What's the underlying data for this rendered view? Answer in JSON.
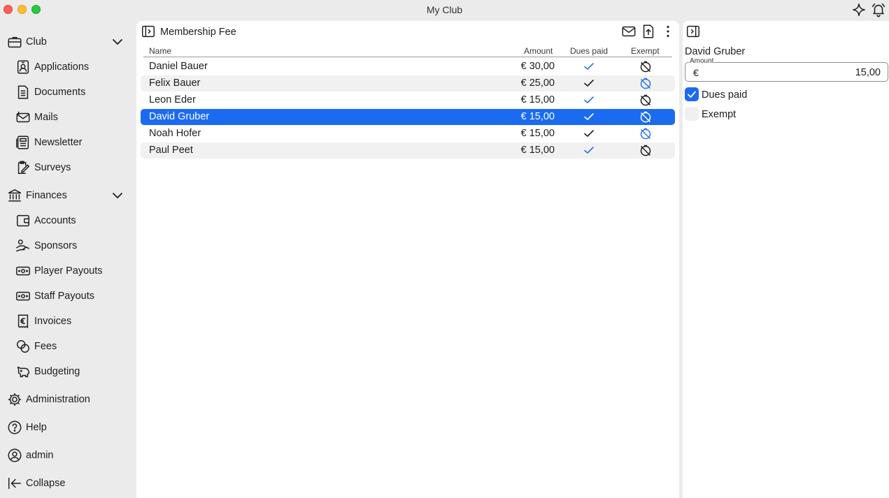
{
  "window": {
    "title": "My Club"
  },
  "sidebar": {
    "club": {
      "label": "Club",
      "items": [
        "Applications",
        "Documents",
        "Mails",
        "Newsletter",
        "Surveys"
      ]
    },
    "finances": {
      "label": "Finances",
      "items": [
        "Accounts",
        "Sponsors",
        "Player Payouts",
        "Staff Payouts",
        "Invoices",
        "Fees",
        "Budgeting"
      ]
    },
    "administration": "Administration",
    "help": "Help",
    "user": "admin",
    "collapse": "Collapse"
  },
  "list": {
    "title": "Membership Fee",
    "columns": {
      "name": "Name",
      "amount": "Amount",
      "dues_paid": "Dues paid",
      "exempt": "Exempt"
    },
    "rows": [
      {
        "name": "Daniel Bauer",
        "amount": "€ 30,00",
        "dues_paid": true,
        "exempt": false
      },
      {
        "name": "Felix Bauer",
        "amount": "€ 25,00",
        "dues_paid": true,
        "exempt": false
      },
      {
        "name": "Leon Eder",
        "amount": "€ 15,00",
        "dues_paid": true,
        "exempt": false
      },
      {
        "name": "David Gruber",
        "amount": "€ 15,00",
        "dues_paid": true,
        "exempt": false
      },
      {
        "name": "Noah Hofer",
        "amount": "€ 15,00",
        "dues_paid": true,
        "exempt": false
      },
      {
        "name": "Paul Peet",
        "amount": "€ 15,00",
        "dues_paid": true,
        "exempt": false
      }
    ],
    "selected_index": 3
  },
  "detail": {
    "name": "David Gruber",
    "amount_label": "Amount",
    "currency": "€",
    "amount_value": "15,00",
    "dues_paid_label": "Dues paid",
    "dues_paid_checked": true,
    "exempt_label": "Exempt",
    "exempt_checked": false
  },
  "colors": {
    "accent": "#1b6bf0",
    "sidebar_bg": "#ebebeb",
    "row_alt": "#f1f1f1"
  }
}
